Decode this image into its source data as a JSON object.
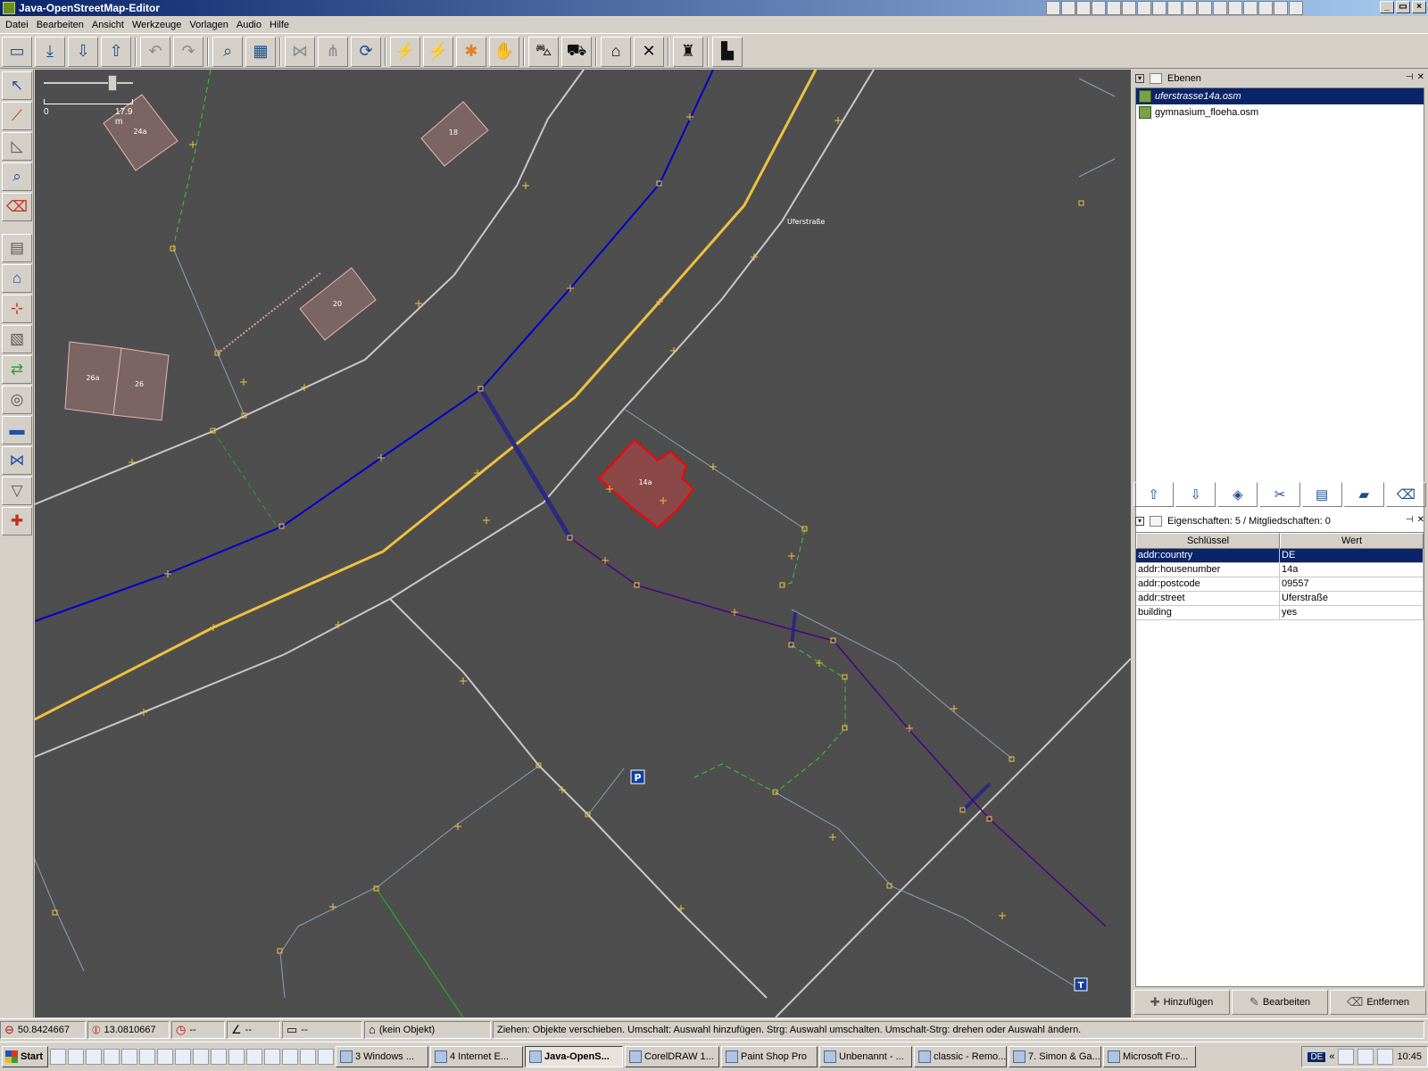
{
  "window": {
    "title": "Java-OpenStreetMap-Editor",
    "buttons": [
      "_",
      "▭",
      "×"
    ]
  },
  "menu": [
    "Datei",
    "Bearbeiten",
    "Ansicht",
    "Werkzeuge",
    "Vorlagen",
    "Audio",
    "Hilfe"
  ],
  "map": {
    "scale_zero": "0",
    "scale_distance": "17.9 m",
    "street_label": "Uferstraße",
    "building_labels": [
      "24a",
      "18",
      "20",
      "26a",
      "26",
      "14a"
    ],
    "parking_label": "P",
    "oneway_label": "T"
  },
  "layers_panel": {
    "title": "Ebenen",
    "layers": [
      {
        "name": "uferstrasse14a.osm",
        "selected": true
      },
      {
        "name": "gymnasium_floeha.osm",
        "selected": false
      }
    ]
  },
  "properties_panel": {
    "title": "Eigenschaften: 5 / Mitgliedschaften: 0",
    "col_key": "Schlüssel",
    "col_value": "Wert",
    "rows": [
      {
        "key": "addr:country",
        "value": "DE"
      },
      {
        "key": "addr:housenumber",
        "value": "14a"
      },
      {
        "key": "addr:postcode",
        "value": "09557"
      },
      {
        "key": "addr:street",
        "value": "Uferstraße"
      },
      {
        "key": "building",
        "value": "yes"
      }
    ],
    "buttons": {
      "add": "Hinzufügen",
      "edit": "Bearbeiten",
      "remove": "Entfernen"
    }
  },
  "status": {
    "lat": "50.8424667",
    "lon": "13.0810667",
    "heading": "--",
    "angle": "--",
    "distance": "--",
    "object": "(kein Objekt)",
    "hint": "Ziehen: Objekte verschieben. Umschalt: Auswahl hinzufügen. Strg: Auswahl umschalten. Umschalt-Strg: drehen oder Auswahl ändern."
  },
  "taskbar": {
    "start": "Start",
    "tasks": [
      "3 Windows ...",
      "4 Internet E...",
      "Java-OpenS...",
      "CorelDRAW 1...",
      "Paint Shop Pro",
      "Unbenannt - ...",
      "classic - Remo...",
      "7. Simon & Ga...",
      "Microsoft Fro..."
    ],
    "lang": "DE",
    "arrows": "«",
    "clock": "10:45"
  },
  "colors": {
    "map_background": "#4e4e4e",
    "selected": "#ff0000",
    "primary_road": "#f0c040",
    "secondary_way": "#0000cc",
    "minor_way": "#c8c8c8",
    "footway": "#33cc33",
    "relation": "#4b0082"
  }
}
